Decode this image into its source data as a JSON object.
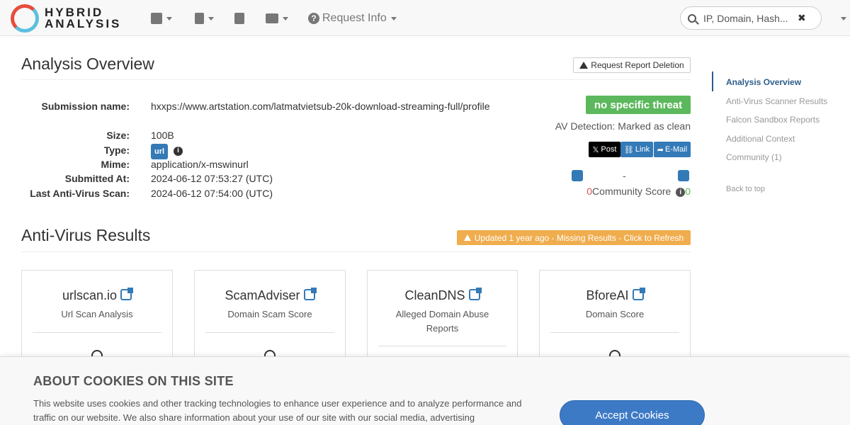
{
  "nav": {
    "brand_line1": "HYBRID",
    "brand_line2": "ANALYSIS",
    "request_info": "Request Info",
    "search_placeholder": "IP, Domain, Hash..."
  },
  "overview": {
    "title": "Analysis Overview",
    "delete_button": "Request Report Deletion",
    "fields": [
      {
        "key": "Submission name:",
        "value": "hxxps://www.artstation.com/latmatvietsub-20k-download-streaming-full/profile"
      },
      {
        "key": "Size:",
        "value": "100B"
      },
      {
        "key": "Type:",
        "value": "url"
      },
      {
        "key": "Mime:",
        "value": "application/x-mswinurl"
      },
      {
        "key": "Submitted At:",
        "value": "2024-06-12 07:53:27 (UTC)"
      },
      {
        "key": "Last Anti-Virus Scan:",
        "value": "2024-06-12 07:54:00 (UTC)"
      }
    ],
    "verdict": "no specific threat",
    "av_detection": "AV Detection: Marked as clean",
    "share_post": "Post",
    "share_link": "Link",
    "share_email": "E-Mail",
    "vote_separator": "-",
    "down_votes": "0",
    "community_score_label": "Community Score",
    "up_votes": "0"
  },
  "av_results": {
    "title": "Anti-Virus Results",
    "refresh": "Updated 1 year ago - Missing Results - Click to Refresh",
    "cards": [
      {
        "name": "urlscan.io",
        "desc": "Url Scan Analysis"
      },
      {
        "name": "ScamAdviser",
        "desc": "Domain Scam Score"
      },
      {
        "name": "CleanDNS",
        "desc": "Alleged Domain Abuse Reports"
      },
      {
        "name": "BforeAI",
        "desc": "Domain Score"
      }
    ]
  },
  "sidebar": {
    "items": [
      "Analysis Overview",
      "Anti-Virus Scanner Results",
      "Falcon Sandbox Reports",
      "Additional Context",
      "Community (1)"
    ],
    "back_to_top": "Back to top"
  },
  "cookies": {
    "title": "ABOUT COOKIES ON THIS SITE",
    "text": "This website uses cookies and other tracking technologies to enhance user experience and to analyze performance and traffic on our website. We also share information about your use of our site with our social media, advertising",
    "accept": "Accept Cookies"
  },
  "colors": {
    "verdict_green": "#5cb85c",
    "refresh_orange": "#f0ad4e",
    "link_blue": "#337ab7",
    "sidebar_active": "#2c5d8a"
  }
}
